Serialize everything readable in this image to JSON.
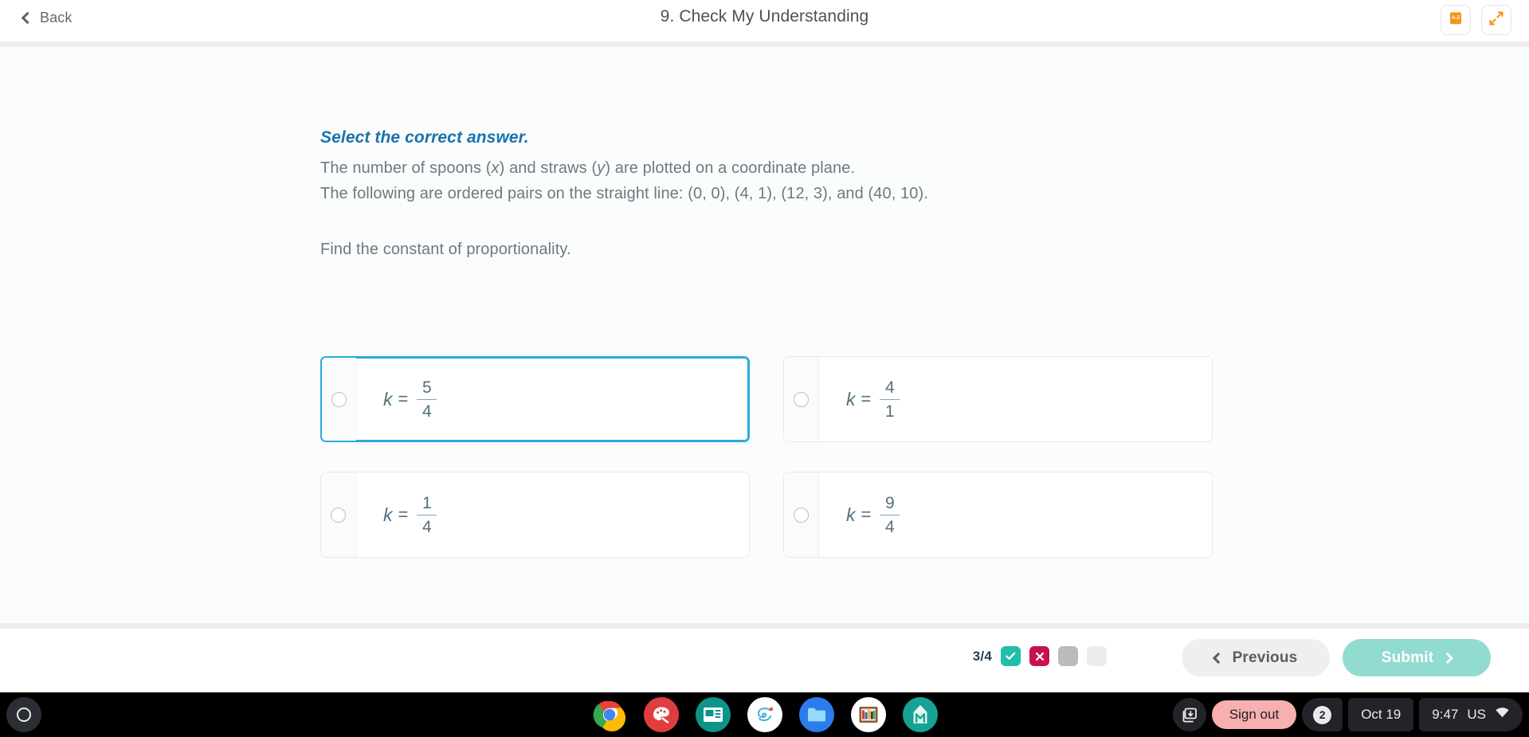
{
  "header": {
    "back_label": "Back",
    "title": "9. Check My Understanding",
    "glossary_icon": "glossary-a-z-book-icon",
    "fullscreen_icon": "fullscreen-expand-icon"
  },
  "question": {
    "instruction": "Select the correct answer.",
    "line1_pre": "The number of spoons (",
    "line1_var_x": "x",
    "line1_mid": ") and straws (",
    "line1_var_y": "y",
    "line1_post": ") are plotted on a coordinate plane.",
    "line2": "The following are ordered pairs on the straight line: (0, 0), (4, 1), (12, 3), and (40, 10).",
    "line3": "Find the constant of proportionality.",
    "options": [
      {
        "id": "option-a",
        "variable": "k",
        "operator": "=",
        "numerator": "5",
        "denominator": "4",
        "selected": false,
        "focused": true
      },
      {
        "id": "option-b",
        "variable": "k",
        "operator": "=",
        "numerator": "4",
        "denominator": "1",
        "selected": false,
        "focused": false
      },
      {
        "id": "option-c",
        "variable": "k",
        "operator": "=",
        "numerator": "1",
        "denominator": "4",
        "selected": false,
        "focused": false
      },
      {
        "id": "option-d",
        "variable": "k",
        "operator": "=",
        "numerator": "9",
        "denominator": "4",
        "selected": false,
        "focused": false
      }
    ]
  },
  "footer": {
    "progress_count": "3/4",
    "progress_items": [
      {
        "state": "correct",
        "icon": "check-icon"
      },
      {
        "state": "incorrect",
        "icon": "x-icon"
      },
      {
        "state": "current",
        "icon": ""
      },
      {
        "state": "upcoming",
        "icon": ""
      }
    ],
    "previous_label": "Previous",
    "submit_label": "Submit"
  },
  "shelf": {
    "launcher_icon": "launcher-circle-icon",
    "apps": [
      {
        "name": "chrome-icon",
        "label": "Chrome",
        "running": true
      },
      {
        "name": "canvas-palette-icon",
        "label": "Canvas",
        "running": false
      },
      {
        "name": "slides-news-icon",
        "label": "Slides",
        "running": false
      },
      {
        "name": "seesaw-swirl-icon",
        "label": "Seesaw",
        "running": false
      },
      {
        "name": "files-folder-icon",
        "label": "Files",
        "running": false
      },
      {
        "name": "bookshelf-icon",
        "label": "Library",
        "running": false
      },
      {
        "name": "edgenuity-m-icon",
        "label": "Edgenuity",
        "running": false
      }
    ],
    "tray": {
      "capture_icon": "screen-capture-icon",
      "sign_out_label": "Sign out",
      "notification_count": "2",
      "date": "Oct 19",
      "time": "9:47",
      "locale": "US",
      "wifi_icon": "wifi-icon"
    }
  },
  "colors": {
    "accent_blue": "#1b72ad",
    "focus_border": "#29aadb",
    "math_text": "#54707e",
    "correct_green": "#20bfa8",
    "incorrect_red": "#c8134a",
    "submit_teal": "#92dbd0",
    "glossary_orange": "#f7941e",
    "signout_pink": "#f7afaf"
  }
}
